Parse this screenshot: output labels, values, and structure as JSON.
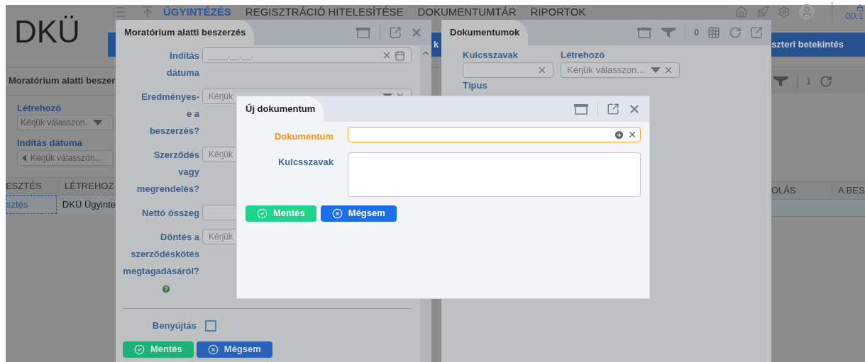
{
  "app": {
    "logo": "DKÜ",
    "nav": [
      {
        "label": "ÜGYINTÉZÉS",
        "selected": true
      },
      {
        "label": "REGISZTRÁCIÓ HITELESÍTÉSE",
        "selected": false
      },
      {
        "label": "DOKUMENTUMTÁR",
        "selected": false
      },
      {
        "label": "RIPORTOK",
        "selected": false
      }
    ],
    "session_time": "00:1",
    "banner_left": "k",
    "banner_right": "szteri betekintés"
  },
  "background_panel": {
    "title": "Moratórium alatti beszer",
    "filters": [
      {
        "label": "Létrehozó",
        "placeholder": "Kérjük válasszon.",
        "kind": "select"
      },
      {
        "label": "Indítás dátuma",
        "placeholder": "Kérjük válasszon...",
        "kind": "range"
      }
    ],
    "columns": [
      "ESZTÉS",
      "LÉTREHOZ"
    ],
    "rows": [
      [
        "sztés",
        "DKÜ Ügyinte"
      ]
    ],
    "right_count": "1",
    "right_columns": [
      "OLÁS",
      "A BES"
    ]
  },
  "procurement_window": {
    "title": "Moratórium alatti beszerzés",
    "fields": [
      {
        "label": [
          "Indítás",
          "dátuma"
        ],
        "kind": "date",
        "placeholder": "____.__.__."
      },
      {
        "label": [
          "Eredményes-",
          "e a",
          "beszerzés?"
        ],
        "kind": "select",
        "placeholder": "Kérjük"
      },
      {
        "label": [
          "Szerződés",
          "vagy",
          "megrendelés?"
        ],
        "kind": "choice",
        "placeholder": "Kérjük"
      },
      {
        "label": [
          "Nettó összeg"
        ],
        "kind": "text"
      },
      {
        "label": [
          "Döntés a",
          "szerződéskötés",
          "megtagadásáról?"
        ],
        "kind": "choice",
        "placeholder": "Kérjük",
        "help": true
      }
    ],
    "submit": {
      "label": "Benyújtás",
      "checked": false
    },
    "buttons": [
      {
        "label": "Mentés",
        "kind": "save"
      },
      {
        "label": "Mégsem",
        "kind": "cancel"
      }
    ]
  },
  "documents_window": {
    "title": "Dokumentumok",
    "count": "0",
    "filters": [
      {
        "label": "Kulcsszavak",
        "kind": "text"
      },
      {
        "label": "Létrehozó",
        "kind": "select",
        "placeholder": "Kérjük válasszon..."
      }
    ],
    "next_label": "Típus"
  },
  "new_document_dialog": {
    "title": "Új dokumentum",
    "fields": [
      {
        "label": "Dokumentum",
        "kind": "file",
        "focused": true
      },
      {
        "label": "Kulcsszavak",
        "kind": "textarea",
        "focused": false
      }
    ],
    "buttons": [
      {
        "label": "Mentés",
        "kind": "save"
      },
      {
        "label": "Mégsem",
        "kind": "cancel"
      }
    ]
  }
}
